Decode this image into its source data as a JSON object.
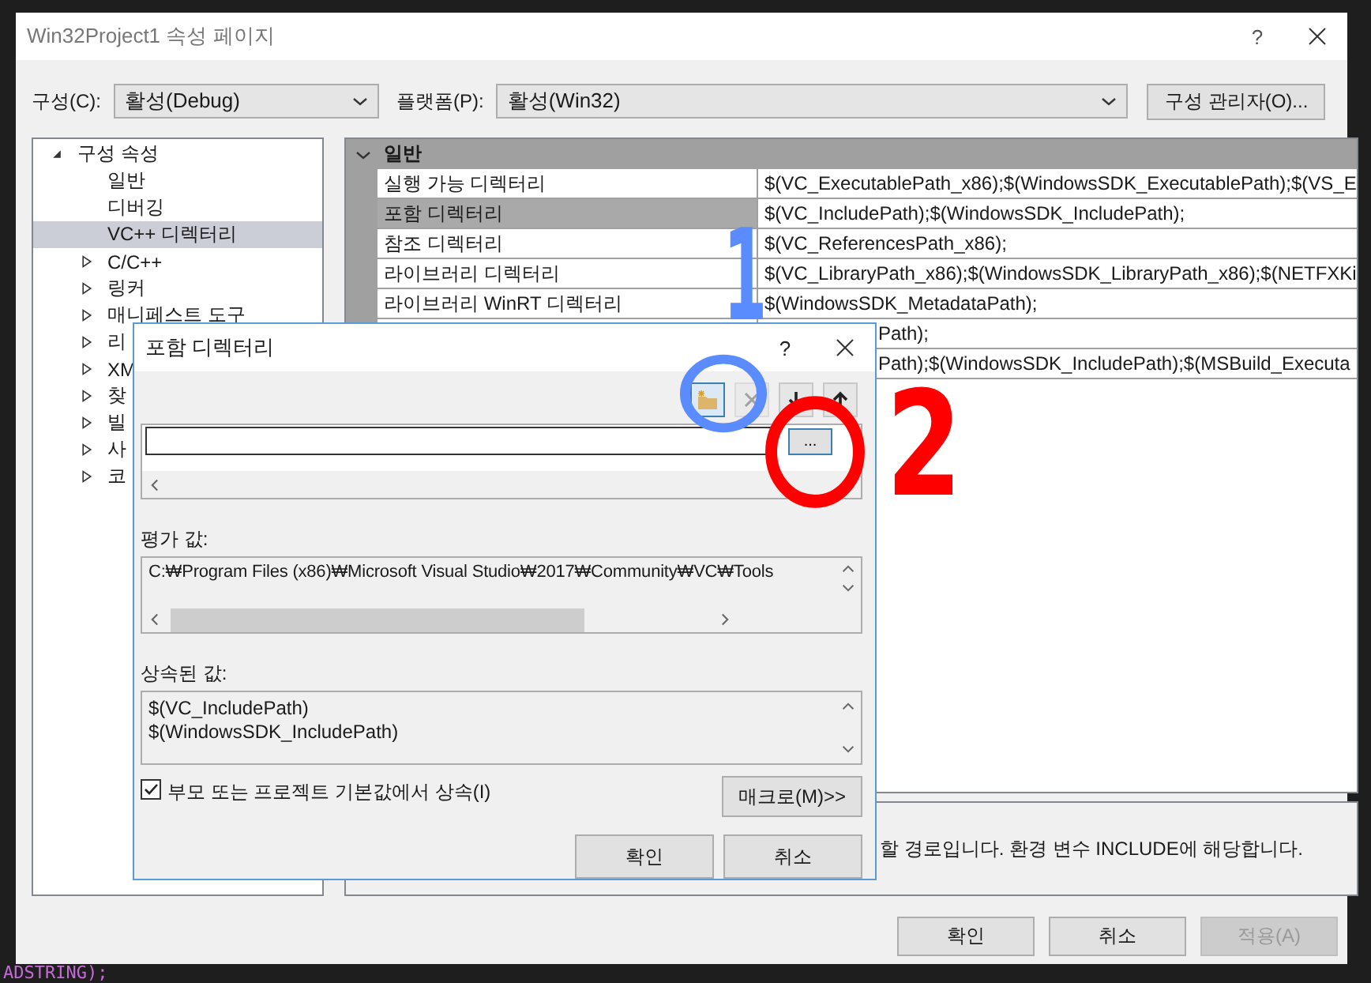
{
  "editor_background": {
    "lines": [
      {
        "text": "ADSTRING);",
        "color": "#c46cd6"
      }
    ]
  },
  "window": {
    "title": "Win32Project1 속성 페이지",
    "help": "?"
  },
  "config_bar": {
    "configuration_label": "구성(C):",
    "configuration_value": "활성(Debug)",
    "platform_label": "플랫폼(P):",
    "platform_value": "활성(Win32)",
    "manager_button": "구성 관리자(O)..."
  },
  "tree": {
    "items": [
      {
        "label": "구성 속성",
        "kind": "group",
        "expanded": true,
        "selected": false,
        "children": [
          {
            "label": "일반",
            "kind": "page",
            "selected": false
          },
          {
            "label": "디버깅",
            "kind": "page",
            "selected": false
          },
          {
            "label": "VC++ 디렉터리",
            "kind": "page",
            "selected": true
          },
          {
            "label": "C/C++",
            "kind": "group",
            "expanded": false,
            "selected": false
          },
          {
            "label": "링커",
            "kind": "group",
            "expanded": false,
            "selected": false
          },
          {
            "label": "매니페스트 도구",
            "kind": "group",
            "expanded": false,
            "selected": false
          },
          {
            "label": "리",
            "kind": "group",
            "expanded": false,
            "selected": false
          },
          {
            "label": "XM",
            "kind": "group",
            "expanded": false,
            "selected": false
          },
          {
            "label": "찾",
            "kind": "group",
            "expanded": false,
            "selected": false
          },
          {
            "label": "빌",
            "kind": "group",
            "expanded": false,
            "selected": false
          },
          {
            "label": "사",
            "kind": "group",
            "expanded": false,
            "selected": false
          },
          {
            "label": "코",
            "kind": "group",
            "expanded": false,
            "selected": false
          }
        ]
      }
    ]
  },
  "grid": {
    "section": {
      "label": "일반",
      "expanded": true
    },
    "rows": [
      {
        "name": "실행 가능 디렉터리",
        "value": "$(VC_ExecutablePath_x86);$(WindowsSDK_ExecutablePath);$(VS_E",
        "selected": false
      },
      {
        "name": "포함 디렉터리",
        "value": "$(VC_IncludePath);$(WindowsSDK_IncludePath);",
        "selected": true
      },
      {
        "name": "참조 디렉터리",
        "value": "$(VC_ReferencesPath_x86);",
        "selected": false
      },
      {
        "name": "라이브러리 디렉터리",
        "value": "$(VC_LibraryPath_x86);$(WindowsSDK_LibraryPath_x86);$(NETFXKi",
        "selected": false
      },
      {
        "name": "라이브러리 WinRT 디렉터리",
        "value": "$(WindowsSDK_MetadataPath);",
        "selected": false
      },
      {
        "value": "Path);"
      },
      {
        "value": "Path);$(WindowsSDK_IncludePath);$(MSBuild_Executa"
      }
    ]
  },
  "description": "할 경로입니다.  환경 변수 INCLUDE에 해당합니다.",
  "buttons": [
    {
      "label": "확인",
      "disabled": false
    },
    {
      "label": "취소",
      "disabled": false
    },
    {
      "label": "적용(A)",
      "disabled": true
    }
  ],
  "include_dialog": {
    "title": "포함 디렉터리",
    "help": "?",
    "toolbar": [
      {
        "kind": "new-folder",
        "disabled": false,
        "selected": true
      },
      {
        "kind": "delete",
        "disabled": true,
        "selected": false
      },
      {
        "kind": "down",
        "disabled": false,
        "selected": false
      },
      {
        "kind": "up",
        "disabled": false,
        "selected": false
      }
    ],
    "browse_button": "...",
    "evaluated_label": "평가 값:",
    "evaluated_value": "C:₩Program Files (x86)₩Microsoft Visual Studio₩2017₩Community₩VC₩Tools",
    "inherited_label": "상속된 값:",
    "inherited_values": [
      "$(VC_IncludePath)",
      "$(WindowsSDK_IncludePath)"
    ],
    "inherit_checkbox": {
      "label": "부모 또는 프로젝트 기본값에서 상속(I)",
      "checked": true
    },
    "macros_button": "매크로(M)>>",
    "buttons": [
      {
        "label": "확인"
      },
      {
        "label": "취소"
      }
    ]
  },
  "annotations": [
    {
      "kind": "mark",
      "text": "1",
      "color": "#5b8cff"
    },
    {
      "kind": "circle",
      "color": "#5b8cff"
    },
    {
      "kind": "circle",
      "color": "#ff0000"
    },
    {
      "kind": "mark",
      "text": "2",
      "color": "#ff0000"
    }
  ]
}
